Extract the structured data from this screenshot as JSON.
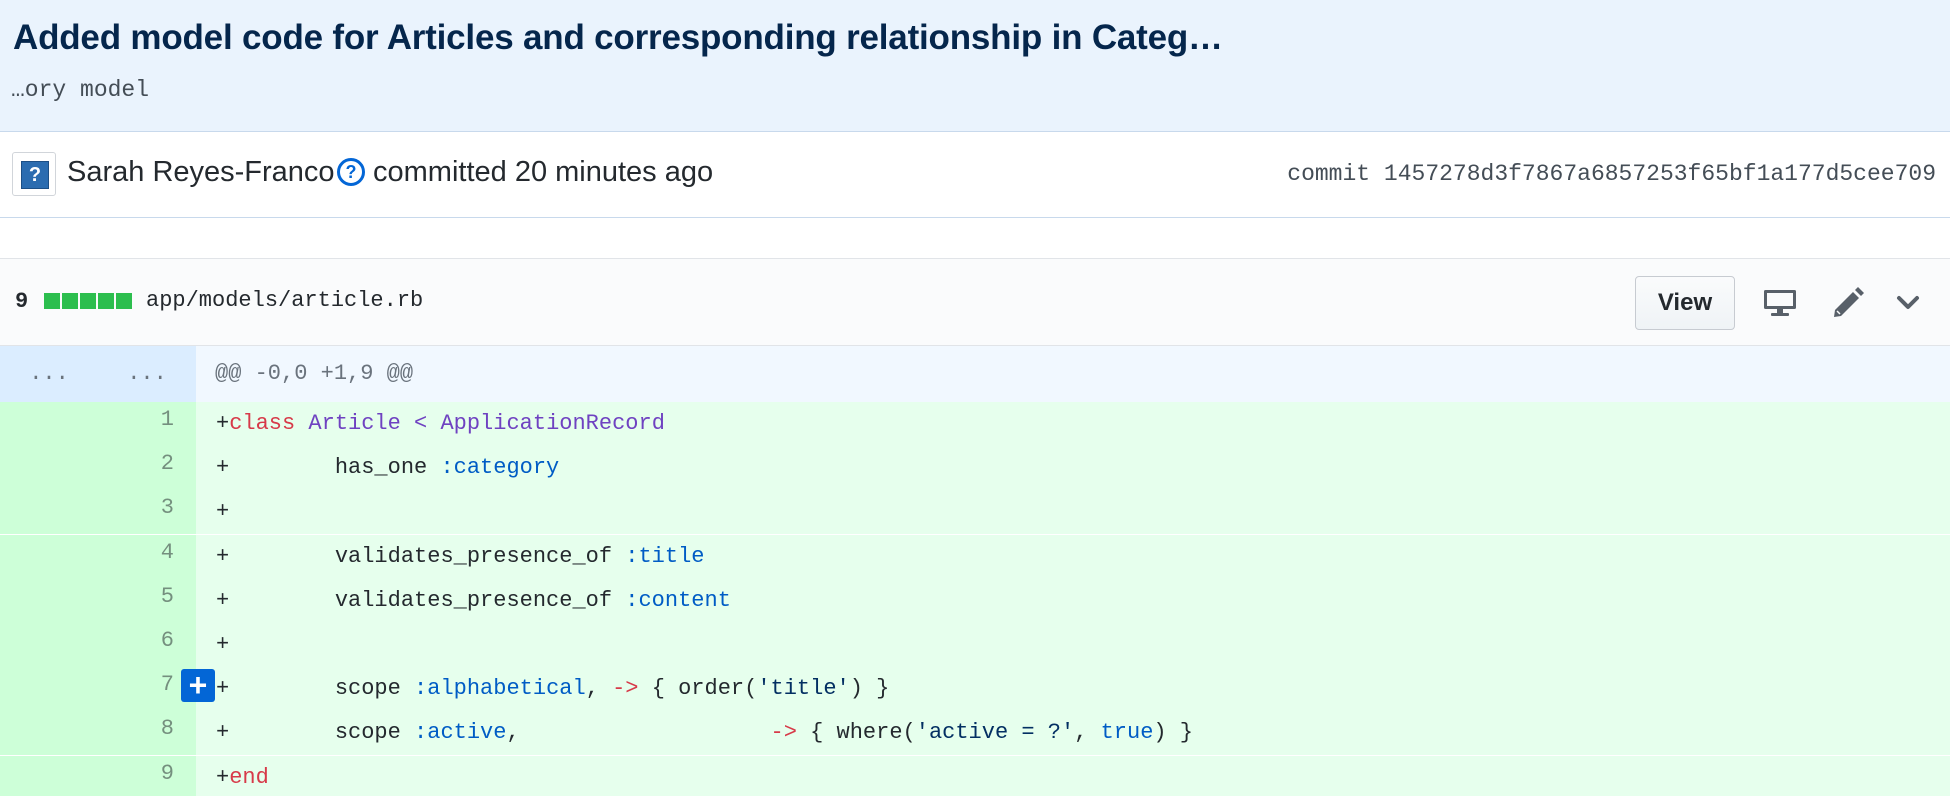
{
  "commit": {
    "title": "Added model code for Articles and corresponding relationship in Categ…",
    "description": "…ory model",
    "author": "Sarah Reyes-Franco",
    "help_glyph": "?",
    "avatar_glyph": "?",
    "committed_text": "committed 20 minutes ago",
    "sha_label": "commit",
    "sha": "1457278d3f7867a6857253f65bf1a177d5cee709"
  },
  "file": {
    "additions": "9",
    "diffstat_blocks": 5,
    "path": "app/models/article.rb",
    "view_label": "View",
    "icons": [
      "display-icon",
      "pencil-icon",
      "chevron-down-icon"
    ]
  },
  "hunk": {
    "old_expander": "...",
    "new_expander": "...",
    "header": "@@ -0,0 +1,9 @@"
  },
  "add_comment_glyph": "+",
  "colors": {
    "addition_bg": "#e6ffed",
    "addition_num_bg": "#cdffd8",
    "hunk_bg": "#f1f8ff",
    "hunk_num_bg": "#dbedff",
    "accent": "#0366d6"
  },
  "diff_lines": [
    {
      "num": "1",
      "tokens": [
        {
          "t": "+",
          "c": ""
        },
        {
          "t": "class",
          "c": "kw"
        },
        {
          "t": " ",
          "c": ""
        },
        {
          "t": "Article",
          "c": "cls"
        },
        {
          "t": " < ",
          "c": "cls"
        },
        {
          "t": "ApplicationRecord",
          "c": "cls"
        }
      ]
    },
    {
      "num": "2",
      "tokens": [
        {
          "t": "+",
          "c": ""
        },
        {
          "t": "        has_one ",
          "c": ""
        },
        {
          "t": ":category",
          "c": "sym"
        }
      ]
    },
    {
      "num": "3",
      "tokens": [
        {
          "t": "+",
          "c": ""
        }
      ]
    },
    {
      "num": "4",
      "tokens": [
        {
          "t": "+",
          "c": ""
        },
        {
          "t": "        validates_presence_of ",
          "c": ""
        },
        {
          "t": ":title",
          "c": "sym"
        }
      ]
    },
    {
      "num": "5",
      "tokens": [
        {
          "t": "+",
          "c": ""
        },
        {
          "t": "        validates_presence_of ",
          "c": ""
        },
        {
          "t": ":content",
          "c": "sym"
        }
      ]
    },
    {
      "num": "6",
      "tokens": [
        {
          "t": "+",
          "c": ""
        }
      ]
    },
    {
      "num": "7",
      "tokens": [
        {
          "t": "+",
          "c": ""
        },
        {
          "t": "        scope ",
          "c": ""
        },
        {
          "t": ":alphabetical",
          "c": "sym"
        },
        {
          "t": ", ",
          "c": ""
        },
        {
          "t": "->",
          "c": "kw"
        },
        {
          "t": " { order(",
          "c": ""
        },
        {
          "t": "'title'",
          "c": "str"
        },
        {
          "t": ") }",
          "c": ""
        }
      ]
    },
    {
      "num": "8",
      "tokens": [
        {
          "t": "+",
          "c": ""
        },
        {
          "t": "        scope ",
          "c": ""
        },
        {
          "t": ":active",
          "c": "sym"
        },
        {
          "t": ",                   ",
          "c": ""
        },
        {
          "t": "->",
          "c": "kw"
        },
        {
          "t": " { where(",
          "c": ""
        },
        {
          "t": "'active = ?'",
          "c": "str"
        },
        {
          "t": ", ",
          "c": ""
        },
        {
          "t": "true",
          "c": "sym"
        },
        {
          "t": ") }",
          "c": ""
        }
      ]
    },
    {
      "num": "9",
      "tokens": [
        {
          "t": "+",
          "c": ""
        },
        {
          "t": "end",
          "c": "kw"
        }
      ]
    }
  ]
}
